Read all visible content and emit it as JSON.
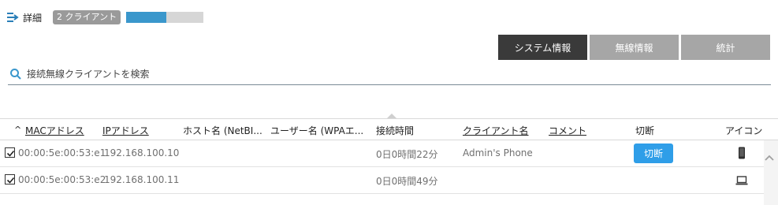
{
  "header": {
    "details_label": "詳細",
    "client_count": "2 クライアント",
    "progress_fraction": 0.52
  },
  "tabs": [
    {
      "label": "システム情報",
      "active": true
    },
    {
      "label": "無線情報",
      "active": false
    },
    {
      "label": "統計",
      "active": false
    }
  ],
  "search": {
    "placeholder": "接続無線クライアントを検索"
  },
  "table": {
    "columns": [
      "MACアドレス",
      "IPアドレス",
      "ホスト名 (NetBI...",
      "ユーザー名 (WPAエ...",
      "接続時間",
      "クライアント名",
      "コメント",
      "切断",
      "アイコン"
    ],
    "sort_indicator": "^",
    "rows": [
      {
        "checked": true,
        "mac": "00:00:5e:00:53:e1",
        "ip": "192.168.100.10",
        "host": "",
        "user": "",
        "time": "0日0時間22分",
        "client_name": "Admin's Phone",
        "comment": "",
        "disconnect_label": "切断",
        "icon": "phone-icon"
      },
      {
        "checked": true,
        "mac": "00:00:5e:00:53:e2",
        "ip": "192.168.100.11",
        "host": "",
        "user": "",
        "time": "0日0時間49分",
        "client_name": "",
        "comment": "",
        "disconnect_label": "",
        "icon": "laptop-icon"
      }
    ]
  },
  "colors": {
    "accent": "#3a97cc",
    "active_tab": "#3a3a3a",
    "inactive_tab": "#a6a6a6",
    "button": "#2f9ee8"
  }
}
